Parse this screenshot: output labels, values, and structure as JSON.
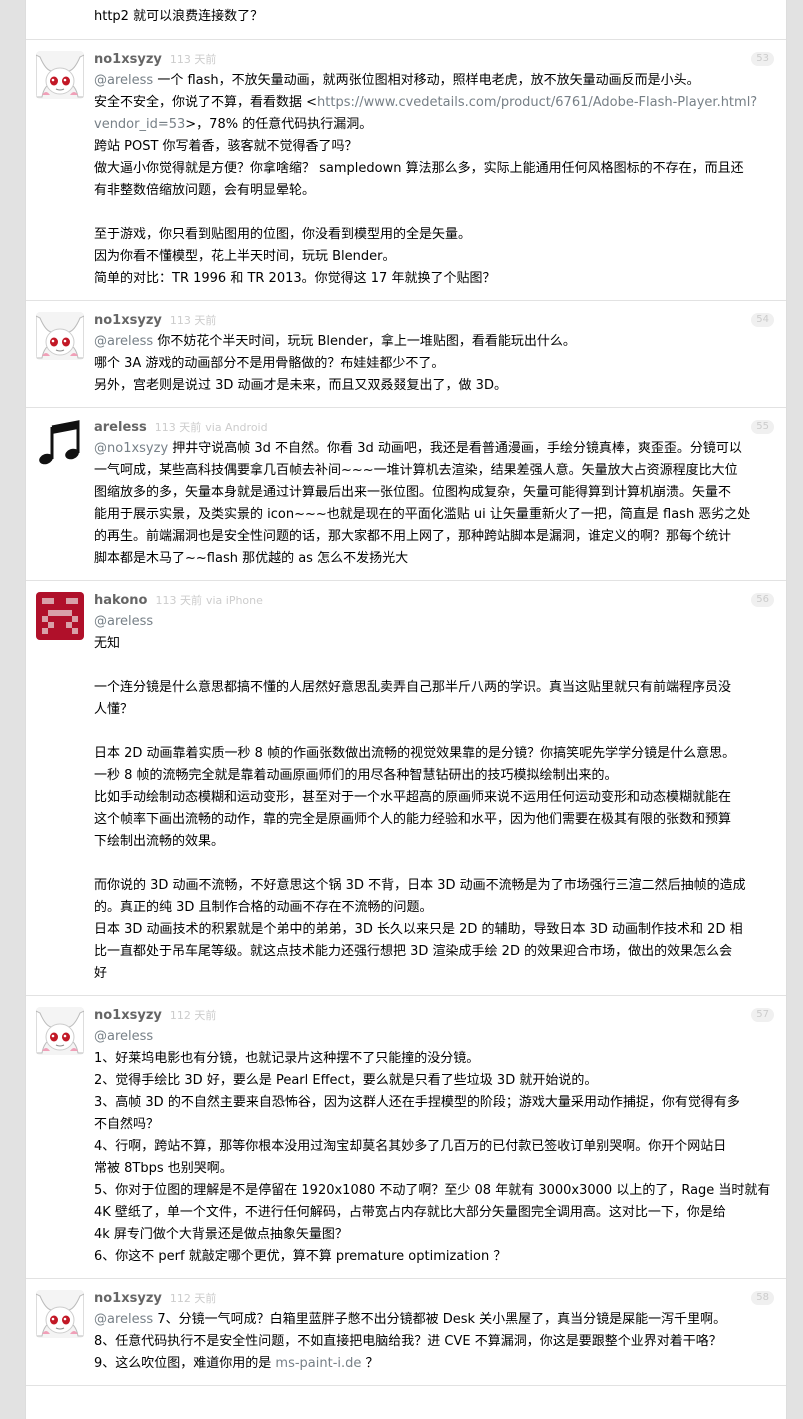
{
  "top_line": "http2 就可以浪费连接数了？",
  "replies": [
    {
      "user": "no1xsyzy",
      "ago": "113 天前",
      "via": "",
      "floor": "53",
      "avatar": "kyubey-avatar",
      "lines": [
        {
          "at": "@areless",
          "text": " 一个 flash，不放矢量动画，就两张位图相对移动，照样电老虎，放不放矢量动画反而是小头。"
        },
        {
          "text": "安全不安全，你说了不算，看看数据 <",
          "link": "https://www.cvedetails.com/product/6761/Adobe-Flash-Player.html?",
          "after": ""
        },
        {
          "link": "vendor_id=53",
          "text": "",
          "after": ">，78% 的任意代码执行漏洞。"
        },
        {
          "text": "跨站 POST 你写着香，骇客就不觉得香了吗？"
        },
        {
          "text": "做大逼小你觉得就是方便？你拿啥缩？ sampledown 算法那么多，实际上能通用任何风格图标的不存在，而且还"
        },
        {
          "text": "有非整数倍缩放问题，会有明显晕轮。"
        },
        {
          "blank": true
        },
        {
          "text": "至于游戏，你只看到贴图用的位图，你没看到模型用的全是矢量。"
        },
        {
          "text": "因为你看不懂模型，花上半天时间，玩玩 Blender。"
        },
        {
          "text": "简单的对比：TR 1996 和 TR 2013。你觉得这 17 年就换了个贴图？"
        }
      ]
    },
    {
      "user": "no1xsyzy",
      "ago": "113 天前",
      "via": "",
      "floor": "54",
      "avatar": "kyubey-avatar",
      "lines": [
        {
          "at": "@areless",
          "text": " 你不妨花个半天时间，玩玩 Blender，拿上一堆贴图，看看能玩出什么。"
        },
        {
          "text": "哪个 3A 游戏的动画部分不是用骨骼做的？布娃娃都少不了。"
        },
        {
          "text": "另外，宫老则是说过 3D 动画才是未来，而且又双叒叕复出了，做 3D。"
        }
      ]
    },
    {
      "user": "areless",
      "ago": "113 天前",
      "via": "via Android",
      "floor": "55",
      "avatar": "music-note-avatar",
      "lines": [
        {
          "at": "@no1xsyzy",
          "text": " 押井守说高帧 3d 不自然。你看 3d 动画吧，我还是看普通漫画，手绘分镜真棒，爽歪歪。分镜可以"
        },
        {
          "text": "一气呵成，某些高科技偶要拿几百帧去补间~~~一堆计算机去渲染，结果差强人意。矢量放大占资源程度比大位"
        },
        {
          "text": "图缩放多的多，矢量本身就是通过计算最后出来一张位图。位图构成复杂，矢量可能得算到计算机崩溃。矢量不"
        },
        {
          "text": "能用于展示实景，及类实景的 icon~~~也就是现在的平面化滥贴 ui 让矢量重新火了一把，简直是 flash 恶劣之处"
        },
        {
          "text": "的再生。前端漏洞也是安全性问题的话，那大家都不用上网了，那种跨站脚本是漏洞，谁定义的啊？那每个统计"
        },
        {
          "text": "脚本都是木马了~~flash 那优越的 as 怎么不发扬光大"
        }
      ]
    },
    {
      "user": "hakono",
      "ago": "113 天前",
      "via": "via iPhone",
      "floor": "56",
      "avatar": "pixel-avatar",
      "lines": [
        {
          "at": "@areless",
          "text": ""
        },
        {
          "text": "无知"
        },
        {
          "blank": true
        },
        {
          "text": "一个连分镜是什么意思都搞不懂的人居然好意思乱卖弄自己那半斤八两的学识。真当这贴里就只有前端程序员没"
        },
        {
          "text": "人懂？"
        },
        {
          "blank": true
        },
        {
          "text": "日本 2D 动画靠着实质一秒 8 帧的作画张数做出流畅的视觉效果靠的是分镜？你搞笑呢先学学分镜是什么意思。"
        },
        {
          "text": "一秒 8 帧的流畅完全就是靠着动画原画师们的用尽各种智慧钻研出的技巧模拟绘制出来的。"
        },
        {
          "text": "比如手动绘制动态模糊和运动变形，甚至对于一个水平超高的原画师来说不运用任何运动变形和动态模糊就能在"
        },
        {
          "text": "这个帧率下画出流畅的动作，靠的完全是原画师个人的能力经验和水平，因为他们需要在极其有限的张数和预算"
        },
        {
          "text": "下绘制出流畅的效果。"
        },
        {
          "blank": true
        },
        {
          "text": "而你说的 3D 动画不流畅，不好意思这个锅 3D 不背，日本 3D 动画不流畅是为了市场强行三渲二然后抽帧的造成"
        },
        {
          "text": "的。真正的纯 3D 且制作合格的动画不存在不流畅的问题。"
        },
        {
          "text": "日本 3D 动画技术的积累就是个弟中的弟弟，3D 长久以来只是 2D 的辅助，导致日本 3D 动画制作技术和 2D 相"
        },
        {
          "text": "比一直都处于吊车尾等级。就这点技术能力还强行想把 3D 渲染成手绘 2D 的效果迎合市场，做出的效果怎么会"
        },
        {
          "text": "好"
        }
      ]
    },
    {
      "user": "no1xsyzy",
      "ago": "112 天前",
      "via": "",
      "floor": "57",
      "avatar": "kyubey-avatar",
      "lines": [
        {
          "at": "@areless",
          "text": ""
        },
        {
          "text": "1、好莱坞电影也有分镜，也就记录片这种摆不了只能撞的没分镜。"
        },
        {
          "text": "2、觉得手绘比 3D 好，要么是 Pearl Effect，要么就是只看了些垃圾 3D 就开始说的。"
        },
        {
          "text": "3、高帧 3D 的不自然主要来自恐怖谷，因为这群人还在手捏模型的阶段；游戏大量采用动作捕捉，你有觉得有多"
        },
        {
          "text": "不自然吗？"
        },
        {
          "text": "4、行啊，跨站不算，那等你根本没用过淘宝却莫名其妙多了几百万的已付款已签收订单别哭啊。你开个网站日"
        },
        {
          "text": "常被 8Tbps 也别哭啊。"
        },
        {
          "text": "5、你对于位图的理解是不是停留在 1920x1080 不动了啊？至少 08 年就有 3000x3000 以上的了，Rage 当时就有"
        },
        {
          "text": "4K 壁纸了，单一个文件，不进行任何解码，占带宽占内存就比大部分矢量图完全调用高。这对比一下，你是给"
        },
        {
          "text": "4k 屏专门做个大背景还是做点抽象矢量图？"
        },
        {
          "text": "6、你这不 perf 就敲定哪个更优，算不算 premature optimization ？"
        }
      ]
    },
    {
      "user": "no1xsyzy",
      "ago": "112 天前",
      "via": "",
      "floor": "58",
      "avatar": "kyubey-avatar",
      "lines": [
        {
          "at": "@areless",
          "text": " 7、分镜一气呵成？白箱里蓝胖子憋不出分镜都被 Desk 关小黑屋了，真当分镜是屎能一泻千里啊。"
        },
        {
          "text": "8、任意代码执行不是安全性问题，不如直接把电脑给我？进 CVE 不算漏洞，你这是要跟整个业界对着干咯？"
        },
        {
          "text": "9、这么吹位图，难道你用的是 ",
          "link": "ms-paint-i.de",
          "after": " ？"
        }
      ]
    }
  ]
}
